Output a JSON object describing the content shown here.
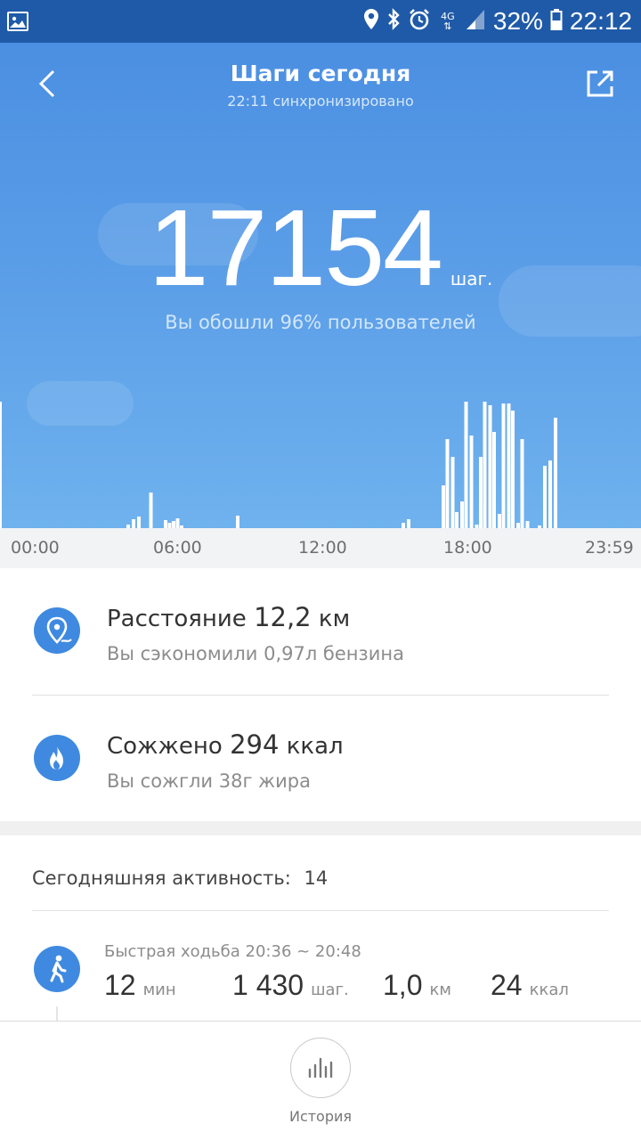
{
  "status_bar": {
    "network": "4G",
    "battery": "32%",
    "time": "22:12"
  },
  "header": {
    "title": "Шаги сегодня",
    "synced": "22:11 синхронизировано"
  },
  "summary": {
    "steps": "17154",
    "steps_unit": "шаг.",
    "percentile_text": "Вы обошли 96% пользователей"
  },
  "chart_data": {
    "type": "bar",
    "x_ticks": [
      "00:00",
      "06:00",
      "12:00",
      "18:00",
      "23:59"
    ],
    "bars": [
      {
        "t": 4.8,
        "v": 4
      },
      {
        "t": 5.0,
        "v": 10
      },
      {
        "t": 5.2,
        "v": 13
      },
      {
        "t": 5.65,
        "v": 40
      },
      {
        "t": 6.2,
        "v": 9
      },
      {
        "t": 6.35,
        "v": 6
      },
      {
        "t": 6.5,
        "v": 8
      },
      {
        "t": 6.65,
        "v": 11
      },
      {
        "t": 6.8,
        "v": 3
      },
      {
        "t": 8.9,
        "v": 14
      },
      {
        "t": 15.1,
        "v": 6
      },
      {
        "t": 15.3,
        "v": 10
      },
      {
        "t": 16.6,
        "v": 48
      },
      {
        "t": 16.75,
        "v": 100
      },
      {
        "t": 16.95,
        "v": 80
      },
      {
        "t": 17.1,
        "v": 18
      },
      {
        "t": 17.3,
        "v": 30
      },
      {
        "t": 17.45,
        "v": 142
      },
      {
        "t": 17.65,
        "v": 104
      },
      {
        "t": 17.85,
        "v": 4
      },
      {
        "t": 18.0,
        "v": 80
      },
      {
        "t": 18.15,
        "v": 142
      },
      {
        "t": 18.35,
        "v": 138
      },
      {
        "t": 18.5,
        "v": 108
      },
      {
        "t": 18.7,
        "v": 16
      },
      {
        "t": 18.85,
        "v": 140
      },
      {
        "t": 19.05,
        "v": 140
      },
      {
        "t": 19.2,
        "v": 132
      },
      {
        "t": 19.4,
        "v": 6
      },
      {
        "t": 19.55,
        "v": 100
      },
      {
        "t": 19.75,
        "v": 8
      },
      {
        "t": 20.2,
        "v": 3
      },
      {
        "t": 20.4,
        "v": 70
      },
      {
        "t": 20.6,
        "v": 76
      },
      {
        "t": 20.8,
        "v": 124
      }
    ],
    "xlim": [
      0,
      24
    ],
    "ylim": [
      0,
      150
    ]
  },
  "distance": {
    "label": "Расстояние",
    "value": "12,2",
    "unit": "км",
    "subtext": "Вы сэкономили 0,97л бензина"
  },
  "calories": {
    "label": "Сожжено",
    "value": "294",
    "unit": "ккал",
    "subtext": "Вы сожгли 38г жира"
  },
  "activity": {
    "title": "Сегодняшняя активность:",
    "count": "14",
    "item": {
      "label": "Быстрая ходьба 20:36 ~ 20:48",
      "minutes": "12",
      "minutes_unit": "мин",
      "steps": "1 430",
      "steps_unit": "шаг.",
      "distance": "1,0",
      "distance_unit": "км",
      "kcal": "24",
      "kcal_unit": "ккал"
    }
  },
  "bottom": {
    "history_label": "История"
  },
  "colors": {
    "accent": "#3f8ae0",
    "hero_top": "#4b8fe2",
    "hero_bottom": "#6fb2ee",
    "status_bar": "#1f5aa8"
  }
}
